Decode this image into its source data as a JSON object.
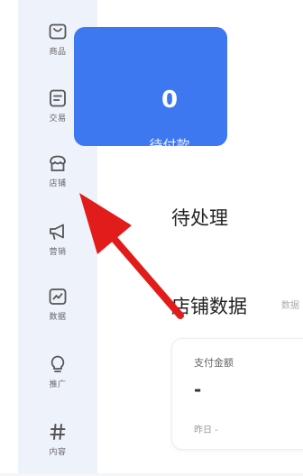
{
  "sidebar": {
    "items": [
      {
        "label": "商品",
        "icon": "bag-icon"
      },
      {
        "label": "交易",
        "icon": "order-icon"
      },
      {
        "label": "店铺",
        "icon": "store-icon"
      },
      {
        "label": "营销",
        "icon": "megaphone-icon"
      },
      {
        "label": "数据",
        "icon": "chart-icon"
      },
      {
        "label": "推广",
        "icon": "lightbulb-icon"
      },
      {
        "label": "内容",
        "icon": "hashtag-icon"
      }
    ]
  },
  "main": {
    "stat": {
      "value": "0",
      "label": "待付款"
    },
    "pending_title": "待处理",
    "store_data": {
      "title": "店铺数据",
      "hint": "数据",
      "metric_label": "支付金额",
      "metric_value": "-",
      "metric_footnote": "昨日 -"
    }
  },
  "colors": {
    "accent": "#3d78f0",
    "arrow": "#e21b1b",
    "sidebar_bg": "#eef2fb"
  }
}
